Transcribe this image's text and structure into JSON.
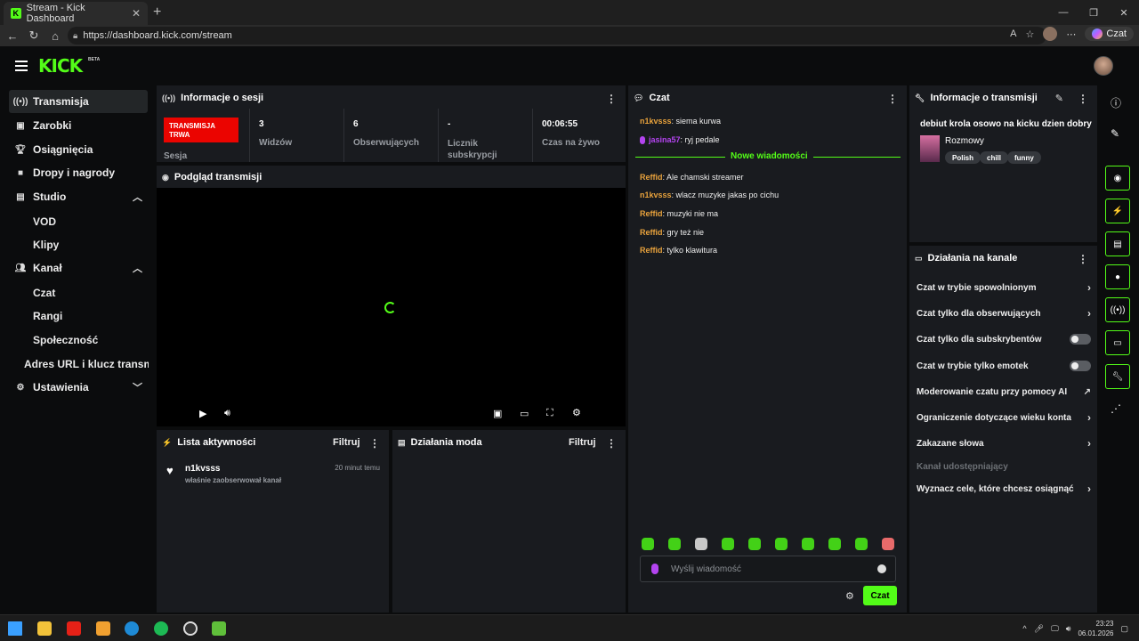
{
  "browser": {
    "tab_title": "Stream - Kick Dashboard",
    "url": "https://dashboard.kick.com/stream",
    "copilot_label": "Czat"
  },
  "header": {
    "logo": "KICK",
    "beta": "BETA"
  },
  "sidebar": {
    "items": [
      {
        "label": "Transmisja",
        "icon": "broadcast-icon"
      },
      {
        "label": "Zarobki",
        "icon": "wallet-icon"
      },
      {
        "label": "Osiągnięcia",
        "icon": "trophy-icon"
      },
      {
        "label": "Dropy i nagrody",
        "icon": "gift-icon"
      },
      {
        "label": "Studio",
        "icon": "studio-icon"
      },
      {
        "label": "Kanał",
        "icon": "people-icon"
      },
      {
        "label": "Ustawienia",
        "icon": "gear-icon"
      }
    ],
    "studio_sub": [
      "VOD",
      "Klipy"
    ],
    "channel_sub": [
      "Czat",
      "Rangi",
      "Społeczność",
      "Adres URL i klucz transmisji"
    ]
  },
  "session": {
    "title": "Informacje o sesji",
    "live_badge": "TRANSMISJA TRWA",
    "session_label": "Sesja",
    "viewers_value": "3",
    "viewers_label": "Widzów",
    "followers_value": "6",
    "followers_label": "Obserwujących",
    "subs_value": "-",
    "subs_label": "Licznik subskrypcji",
    "live_time_value": "00:06:55",
    "live_time_label": "Czas na żywo"
  },
  "preview": {
    "title": "Podgląd transmisji"
  },
  "activity": {
    "title": "Lista aktywności",
    "filter": "Filtruj",
    "items": [
      {
        "user": "n1kvsss",
        "text": "właśnie zaobserwował kanał",
        "time": "20 minut temu"
      }
    ]
  },
  "mod": {
    "title": "Działania moda",
    "filter": "Filtruj"
  },
  "chat": {
    "title": "Czat",
    "messages_before": [
      {
        "user": "n1kvsss",
        "text": ": siema kurwa",
        "color": "#e8a23c"
      },
      {
        "user": "jasina57",
        "text": ": ryj pedale",
        "color": "#b444f0"
      }
    ],
    "new_messages_label": "Nowe wiadomości",
    "messages_after": [
      {
        "user": "Reffid",
        "text": ": Ale chamski streamer",
        "color": "#e8a23c"
      },
      {
        "user": "n1kvsss",
        "text": ": wlacz muzyke jakas po cichu",
        "color": "#e8a23c"
      },
      {
        "user": "Reffid",
        "text": ": muzyki nie ma",
        "color": "#e8a23c"
      },
      {
        "user": "Reffid",
        "text": ": gry też nie",
        "color": "#e8a23c"
      },
      {
        "user": "Reffid",
        "text": ": tylko klawitura",
        "color": "#e8a23c"
      }
    ],
    "input_placeholder": "Wyślij wiadomość",
    "send_label": "Czat"
  },
  "stream_info": {
    "title": "Informacje o transmisji",
    "stream_title": "debiut krola osowo na kicku dzien dobry",
    "category": "Rozmowy",
    "tags": [
      "Polish",
      "chill",
      "funny"
    ]
  },
  "channel_actions": {
    "title": "Działania na kanale",
    "rows": [
      {
        "label": "Czat w trybie spowolnionym",
        "control": "arrow"
      },
      {
        "label": "Czat tylko dla obserwujących",
        "control": "arrow"
      },
      {
        "label": "Czat tylko dla subskrybentów",
        "control": "toggle"
      },
      {
        "label": "Czat w trybie tylko emotek",
        "control": "toggle"
      },
      {
        "label": "Moderowanie czatu przy pomocy AI",
        "control": "external"
      },
      {
        "label": "Ograniczenie dotyczące wieku konta",
        "control": "arrow"
      },
      {
        "label": "Zakazane słowa",
        "control": "arrow"
      }
    ],
    "shared_label": "Kanał udostępniający",
    "goals_label": "Wyznacz cele, które chcesz osiągnąć"
  },
  "taskbar": {
    "time": "23:23",
    "date": "06.01.2026"
  },
  "colors": {
    "accent": "#53fc18",
    "live": "#eb0400",
    "panel": "#191b1f",
    "bg": "#0b0c0d"
  }
}
